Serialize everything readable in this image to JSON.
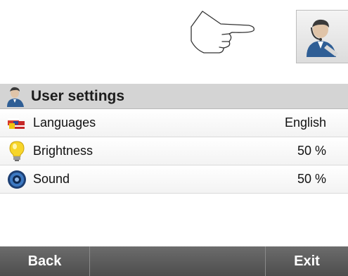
{
  "header": {
    "title": "User settings"
  },
  "settings": [
    {
      "label": "Languages",
      "value": "English",
      "icon": "flags-icon"
    },
    {
      "label": "Brightness",
      "value": "50 %",
      "icon": "lightbulb-icon"
    },
    {
      "label": "Sound",
      "value": "50 %",
      "icon": "speaker-icon"
    }
  ],
  "footer": {
    "back_label": "Back",
    "exit_label": "Exit"
  },
  "colors": {
    "header_bg": "#d4d4d4",
    "footer_bg": "#5d5d5d"
  }
}
